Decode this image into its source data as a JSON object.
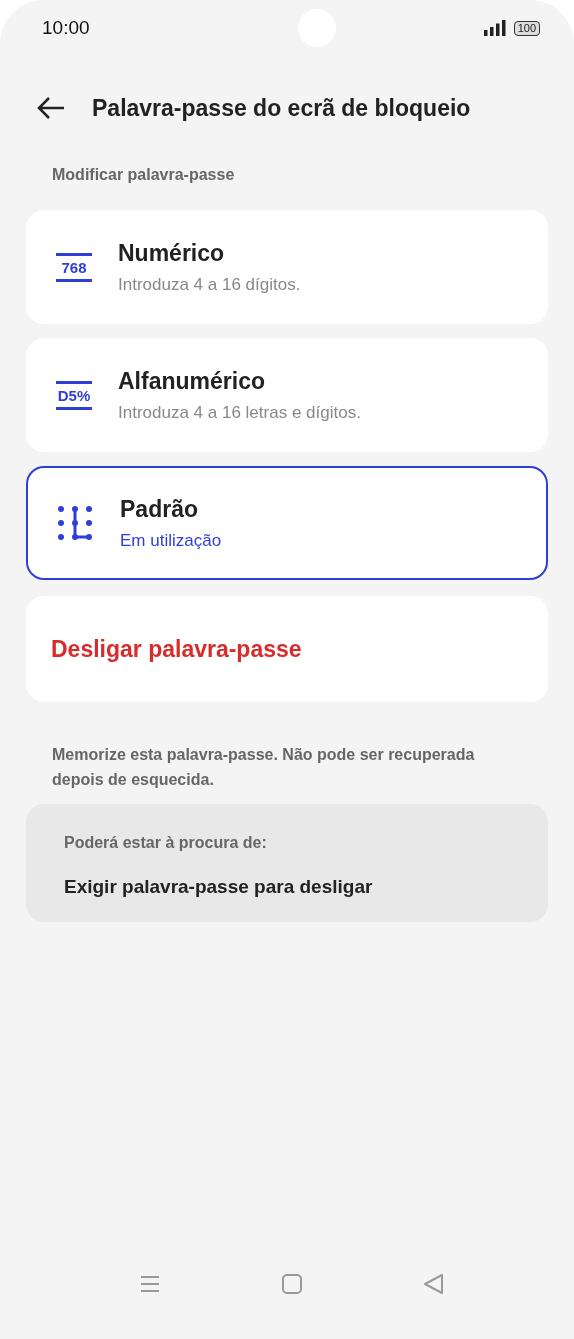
{
  "status_bar": {
    "time": "10:00",
    "battery": "100"
  },
  "header": {
    "title": "Palavra-passe do ecrã de bloqueio"
  },
  "section_label": "Modificar palavra-passe",
  "options": [
    {
      "kind": "numeric",
      "icon_text": "768",
      "title": "Numérico",
      "subtitle": "Introduza 4 a 16 dígitos.",
      "selected": false
    },
    {
      "kind": "alphanumeric",
      "icon_text": "D5%",
      "title": "Alfanumérico",
      "subtitle": "Introduza 4 a 16 letras e dígitos.",
      "selected": false
    },
    {
      "kind": "pattern",
      "title": "Padrão",
      "subtitle": "Em utilização",
      "selected": true
    }
  ],
  "turn_off": "Desligar palavra-passe",
  "note": "Memorize esta palavra-passe. Não pode ser recuperada depois de esquecida.",
  "suggestions": {
    "label": "Poderá estar à procura de:",
    "items": [
      "Exigir palavra-passe para desligar"
    ]
  }
}
